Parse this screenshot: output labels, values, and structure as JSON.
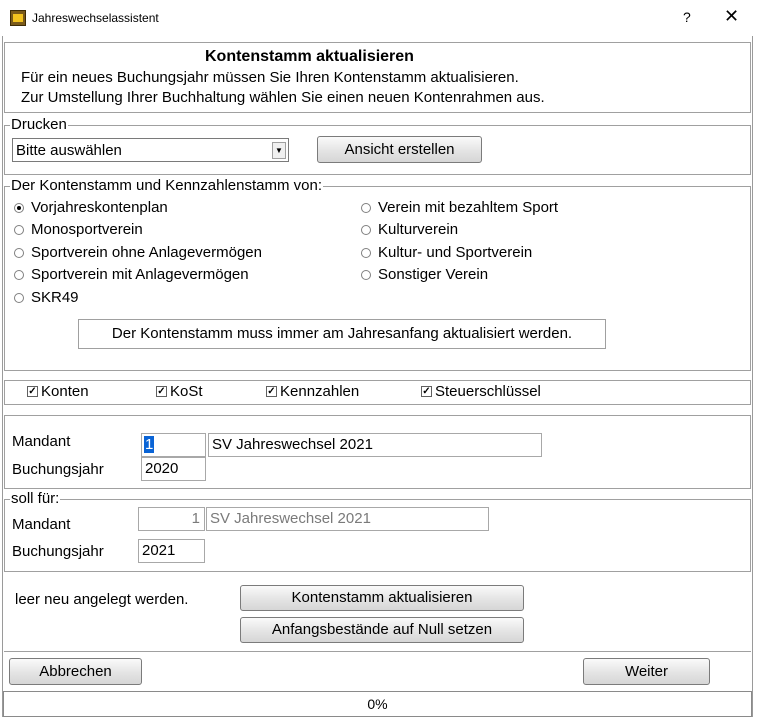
{
  "window": {
    "title": "Jahreswechselassistent",
    "help": "?",
    "close": "✕"
  },
  "header": {
    "title": "Kontenstamm aktualisieren",
    "line1": "Für ein neues Buchungsjahr müssen Sie Ihren Kontenstamm aktualisieren.",
    "line2": "Zur Umstellung Ihrer Buchhaltung wählen Sie einen neuen Kontenrahmen aus."
  },
  "print": {
    "legend": "Drucken",
    "select_value": "Bitte auswählen",
    "preview_button": "Ansicht erstellen"
  },
  "source": {
    "legend": "Der Kontenstamm und  Kennzahlenstamm von:",
    "options": [
      {
        "label": "Vorjahreskontenplan",
        "selected": true
      },
      {
        "label": "Monosportverein",
        "selected": false
      },
      {
        "label": "Sportverein ohne Anlagevermögen",
        "selected": false
      },
      {
        "label": "Sportverein mit Anlagevermögen",
        "selected": false
      },
      {
        "label": "SKR49",
        "selected": false
      },
      {
        "label": "Verein mit bezahltem Sport",
        "selected": false
      },
      {
        "label": "Kulturverein",
        "selected": false
      },
      {
        "label": "Kultur- und Sportverein",
        "selected": false
      },
      {
        "label": "Sonstiger Verein",
        "selected": false
      }
    ],
    "info": "Der Kontenstamm muss immer am Jahresanfang aktualisiert werden."
  },
  "checks": [
    {
      "label": "Konten",
      "checked": true
    },
    {
      "label": "KoSt",
      "checked": true
    },
    {
      "label": "Kennzahlen",
      "checked": true
    },
    {
      "label": "Steuerschlüssel",
      "checked": true
    }
  ],
  "current": {
    "mandant_label": "Mandant",
    "mandant_no": "1",
    "mandant_name": "SV Jahreswechsel 2021",
    "year_label": "Buchungsjahr",
    "year": "2020"
  },
  "target": {
    "legend": "soll für:",
    "mandant_label": "Mandant",
    "mandant_no": "1",
    "mandant_name": "SV Jahreswechsel 2021",
    "year_label": "Buchungsjahr",
    "year": "2021"
  },
  "actions": {
    "note": "leer neu angelegt werden.",
    "update_button": "Kontenstamm aktualisieren",
    "reset_button": "Anfangsbestände auf Null setzen"
  },
  "footer": {
    "cancel": "Abbrechen",
    "next": "Weiter",
    "progress_text": "0%",
    "progress": 0
  }
}
